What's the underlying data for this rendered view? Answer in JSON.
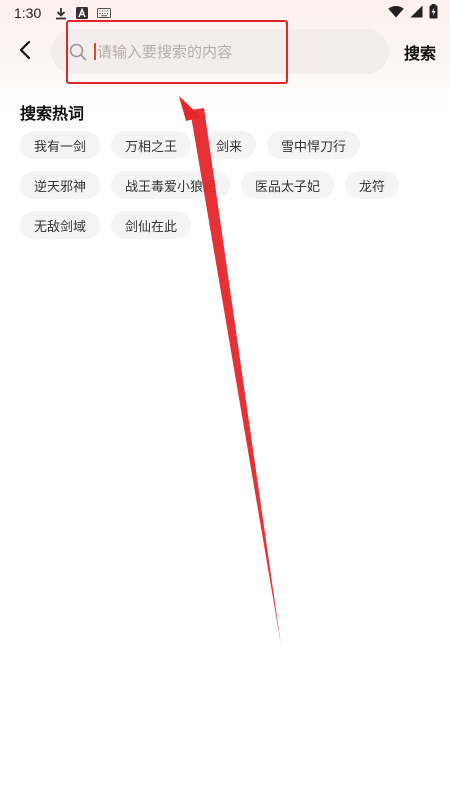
{
  "status_bar": {
    "time": "1:30",
    "icons": [
      "download-icon",
      "a-badge-icon",
      "keyboard-icon",
      "wifi-icon",
      "signal-icon",
      "battery-icon"
    ]
  },
  "header": {
    "back_icon": "chevron-left-icon",
    "search_placeholder": "请输入要搜索的内容",
    "search_value": "",
    "search_button_label": "搜索"
  },
  "hot_words": {
    "title": "搜索热词",
    "rows": [
      [
        "我有一剑",
        "万相之王",
        "剑来",
        "雪中悍刀行"
      ],
      [
        "逆天邪神",
        "战王毒爱小狼妃",
        "医品太子妃",
        "龙符"
      ],
      [
        "无敌剑域",
        "剑仙在此"
      ]
    ]
  },
  "colors": {
    "accent": "#e3452b",
    "annotation": "#e5262a",
    "tag_bg": "#f4f4f4",
    "search_bg": "#f3eeed"
  }
}
